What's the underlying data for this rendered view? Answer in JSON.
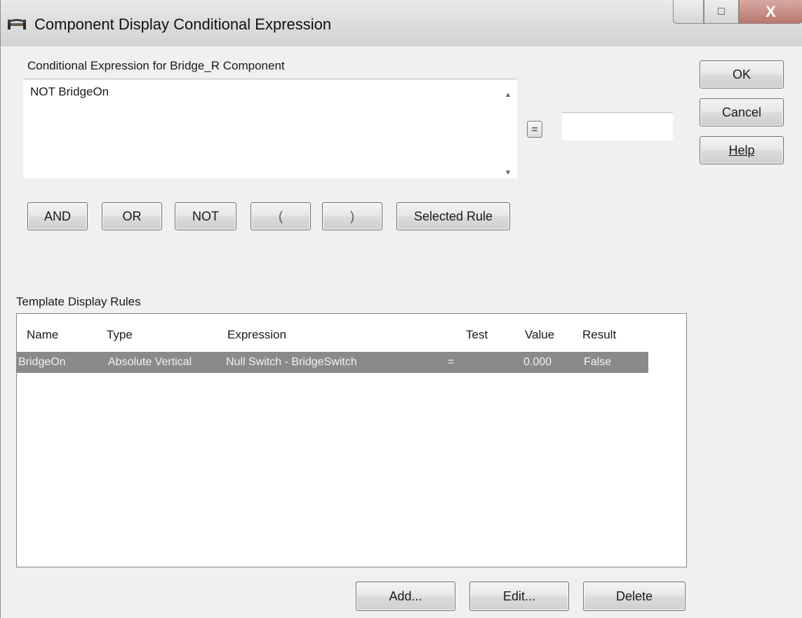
{
  "window": {
    "title": "Component Display Conditional Expression",
    "controls": {
      "minimize": "",
      "maximize": "□",
      "close": "X"
    }
  },
  "expression": {
    "label": "Conditional Expression for Bridge_R Component",
    "value": "NOT BridgeOn"
  },
  "equals_button": "=",
  "compare_value": "",
  "operators": [
    "AND",
    "OR",
    "NOT",
    "(",
    ")",
    "Selected Rule"
  ],
  "side_buttons": {
    "ok": "OK",
    "cancel": "Cancel",
    "help": "Help"
  },
  "rules": {
    "label": "Template Display Rules",
    "columns": [
      "Name",
      "Type",
      "Expression",
      "Test",
      "Value",
      "Result"
    ],
    "rows": [
      {
        "name": "BridgeOn",
        "type": "Absolute Vertical",
        "expression": "Null Switch - BridgeSwitch",
        "test": "=",
        "value": "0.000",
        "result": "False"
      }
    ]
  },
  "bottom_buttons": {
    "add": "Add...",
    "edit": "Edit...",
    "delete": "Delete"
  }
}
